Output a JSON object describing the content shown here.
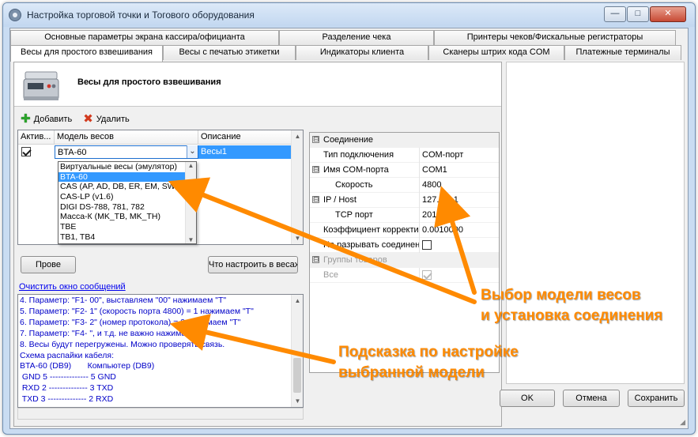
{
  "window": {
    "title": "Настройка торговой точки и Тогового оборудования",
    "minimize": "—",
    "maximize": "□",
    "close": "✕"
  },
  "tabs": {
    "row1": [
      "Основные параметры экрана кассира/официанта",
      "Разделение чека",
      "Принтеры чеков/Фискальные регистраторы"
    ],
    "row2": [
      "Весы для простого взвешивания",
      "Весы с печатью этикетки",
      "Индикаторы клиента",
      "Сканеры штрих кода COM",
      "Платежные терминалы"
    ],
    "active_index": 0
  },
  "header": {
    "title": "Весы для простого взвешивания",
    "icon": "scale-icon"
  },
  "toolbar": {
    "add": "Добавить",
    "delete": "Удалить"
  },
  "grid": {
    "columns": [
      "Актив...",
      "Модель весов",
      "Описание"
    ],
    "rows": [
      {
        "active": true,
        "model": "BTA-60",
        "description": "Весы1"
      }
    ]
  },
  "model_dropdown": {
    "options": [
      "Виртуальные весы (эмулятор)",
      "BTA-60",
      "CAS (AP, AD, DB, ER, EM, SW,",
      "CAS-LP (v1.6)",
      "DIGI DS-788, 781, 782",
      "Масса-К (MK_TB, MK_TH)",
      "TBE",
      "TB1, TB4"
    ],
    "selected_index": 1
  },
  "buttons": {
    "check_partial": "Прове",
    "how_to_setup": "Что настроить в весах",
    "ok": "OK",
    "cancel": "Отмена",
    "save": "Сохранить"
  },
  "log": {
    "clear_link": "Очистить окно сообщений",
    "lines": [
      "4. Параметр: \"F1- 00\", выставляем \"00\" нажимаем \"T\"",
      "5. Параметр: \"F2- 1\" (скорость порта 4800) = 1 нажимаем \"T\"",
      "6. Параметр: \"F3- 2\" (номер протокола) = 2 нажимаем \"T\"",
      "7. Параметр: \"F4- \", и т.д. не важно нажимаем \"T\"",
      "8. Весы будут перегружены. Можно проверять связь.",
      "Схема распайки кабеля:",
      "BTA-60 (DB9)       Компьютер (DB9)",
      " GND 5 -------------- 5 GND",
      " RXD 2 -------------- 3 TXD",
      " TXD 3 -------------- 2 RXD"
    ]
  },
  "properties": {
    "rows": [
      {
        "kind": "category",
        "toggle": "⊟",
        "name": "Соединение"
      },
      {
        "kind": "prop",
        "name": "Тип подключения",
        "value": "COM-порт"
      },
      {
        "kind": "subcat",
        "toggle": "⊟",
        "name": "Имя COM-порта",
        "value": "COM1"
      },
      {
        "kind": "subprop",
        "name": "Скорость",
        "value": "4800"
      },
      {
        "kind": "subcat",
        "toggle": "⊟",
        "name": "IP / Host",
        "value": "127.0.0.1"
      },
      {
        "kind": "subprop",
        "name": "TCP порт",
        "value": "2010"
      },
      {
        "kind": "prop",
        "name": "Коэффициент корректи",
        "value": "0.0010000"
      },
      {
        "kind": "prop-check",
        "name": "Не разрывать соединен",
        "checked": false
      },
      {
        "kind": "category-dis",
        "toggle": "⊟",
        "name": "Группы товаров"
      },
      {
        "kind": "prop-check-dis",
        "name": "Все",
        "checked": true
      }
    ]
  },
  "annotations": {
    "model_select": [
      "Выбор модели весов",
      "и установка соединения"
    ],
    "hint": [
      "Подсказка по настройке",
      "выбранной модели"
    ],
    "color": "#ff8a00"
  }
}
